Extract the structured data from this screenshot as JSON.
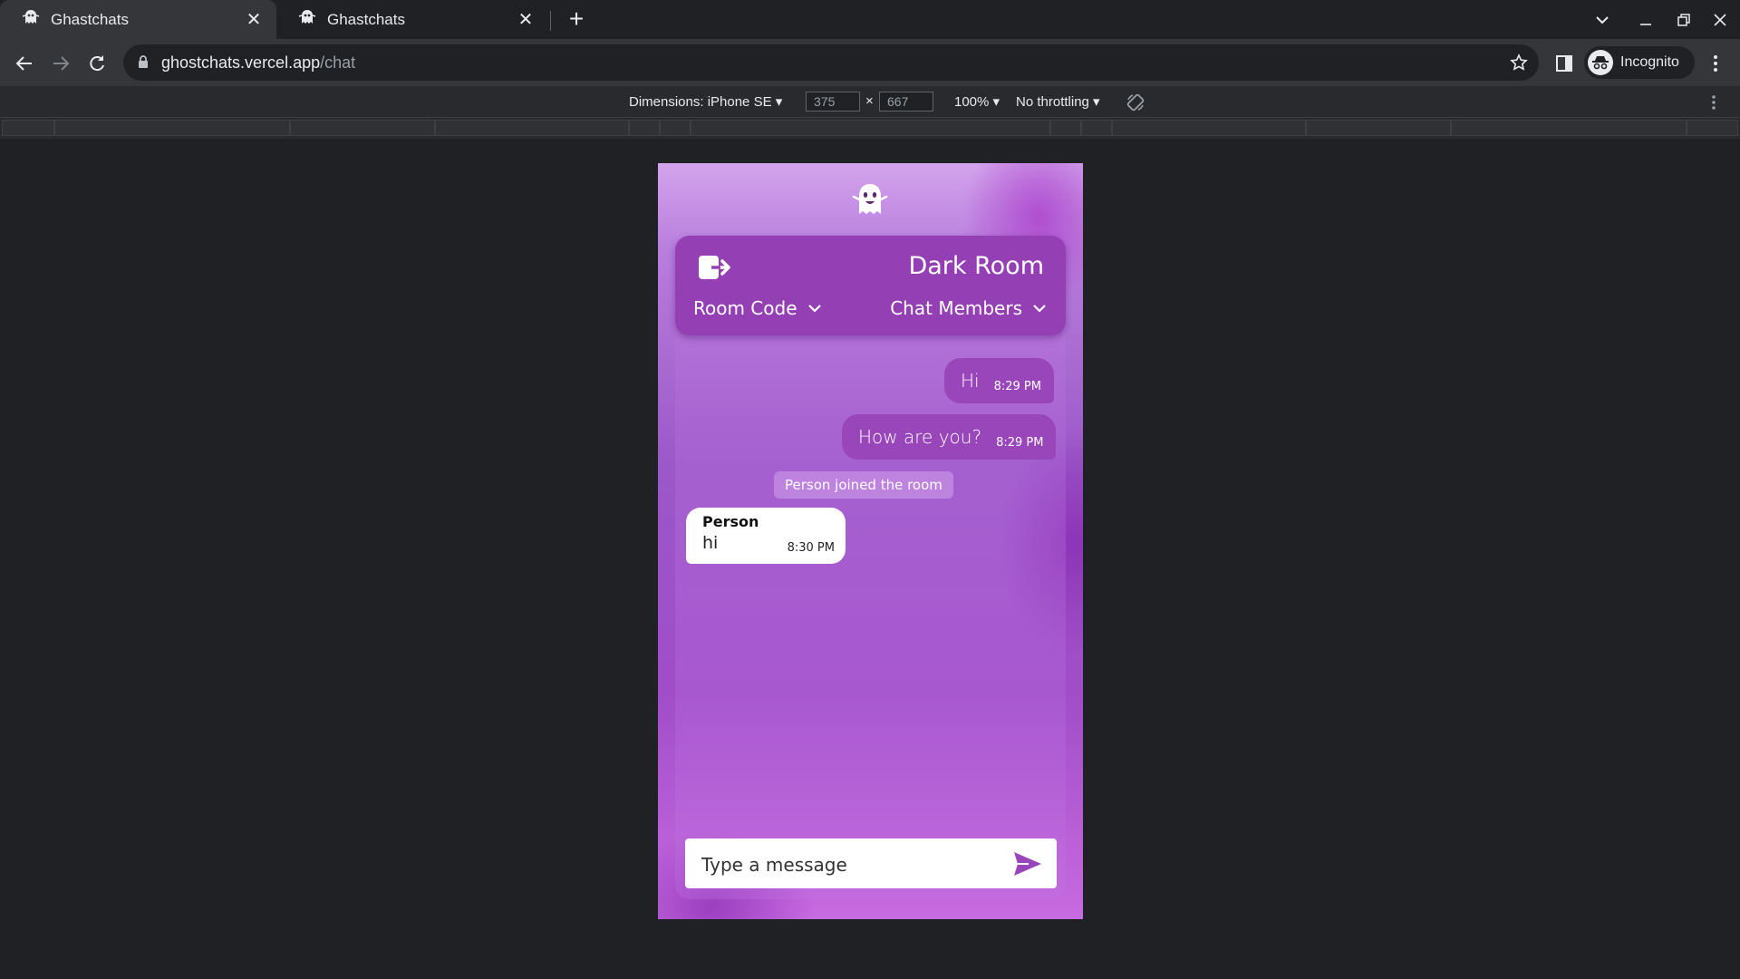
{
  "browser": {
    "tabs": [
      {
        "title": "Ghastchats",
        "active": true
      },
      {
        "title": "Ghastchats",
        "active": false
      }
    ],
    "url": {
      "host": "ghostchats.vercel.app",
      "path": "/chat"
    },
    "profile_label": "Incognito"
  },
  "devtools": {
    "device_label": "Dimensions: iPhone SE",
    "width": "375",
    "height": "667",
    "times": "×",
    "zoom": "100%",
    "throttling": "No throttling"
  },
  "app": {
    "room_title": "Dark Room",
    "room_code_label": "Room Code",
    "members_label": "Chat Members",
    "messages": [
      {
        "from_me": true,
        "text": "Hi",
        "time": "8:29 PM"
      },
      {
        "from_me": true,
        "text": "How are you?",
        "time": "8:29 PM"
      },
      {
        "system": true,
        "text": "Person joined the room"
      },
      {
        "from_me": false,
        "sender": "Person",
        "text": "hi",
        "time": "8:30 PM"
      }
    ],
    "composer_placeholder": "Type a message"
  },
  "colors": {
    "header": "#9440b4",
    "my_bubble": "#9a46bb",
    "page_bg": "#202124"
  }
}
